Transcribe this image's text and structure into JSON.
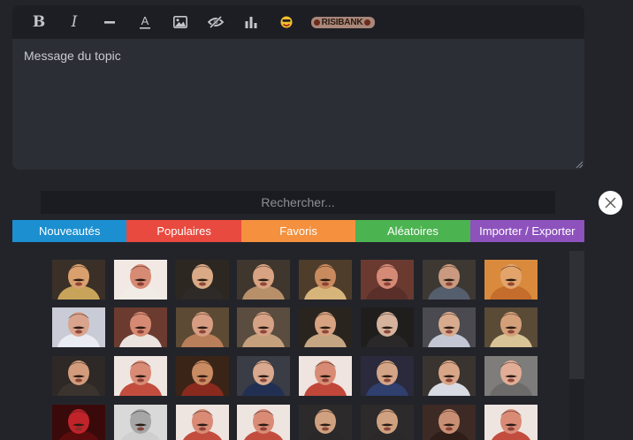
{
  "editor": {
    "toolbar": [
      {
        "name": "bold-button",
        "icon": "bold-icon",
        "label": "B"
      },
      {
        "name": "italic-button",
        "icon": "italic-icon",
        "label": "I"
      },
      {
        "name": "strikethrough-button",
        "icon": "strikethrough-icon"
      },
      {
        "name": "font-color-button",
        "icon": "font-color-icon",
        "label": "A"
      },
      {
        "name": "image-button",
        "icon": "image-icon"
      },
      {
        "name": "spoiler-button",
        "icon": "eye-slash-icon"
      },
      {
        "name": "poll-button",
        "icon": "bar-chart-icon"
      },
      {
        "name": "smiley-button",
        "icon": "smiley-icon"
      },
      {
        "name": "risibank-button",
        "icon": "risibank-logo-icon",
        "logo_text": "RISIBANK"
      }
    ],
    "placeholder": "Message du topic"
  },
  "search": {
    "placeholder": "Rechercher..."
  },
  "tabs": [
    {
      "label": "Nouveautés",
      "color": "#1c8fd0"
    },
    {
      "label": "Populaires",
      "color": "#e84a3f"
    },
    {
      "label": "Favoris",
      "color": "#f4903e"
    },
    {
      "label": "Aléatoires",
      "color": "#4cb351"
    },
    {
      "label": "Importer / Exporter",
      "color": "#8e52bd"
    }
  ],
  "colors": {
    "background": "#23242a",
    "editor": "#2c2e35",
    "toolbar": "#1d1e23",
    "search": "#1b1c21"
  },
  "stickers": {
    "rows": [
      [
        {
          "bg": "#3a3028",
          "skin": "#d9a06e",
          "shirt": "#c8a45a"
        },
        {
          "bg": "#f2e9e4",
          "skin": "#d78a74",
          "shirt": "#f1ece6"
        },
        {
          "bg": "#2d2722",
          "skin": "#d9aa85",
          "shirt": "#2e2a27"
        },
        {
          "bg": "#3f362e",
          "skin": "#d8a382",
          "shirt": "#b7906a"
        },
        {
          "bg": "#4e3d2b",
          "skin": "#c98a5e",
          "shirt": "#d7b47a"
        },
        {
          "bg": "#6a3a30",
          "skin": "#d58a76",
          "shirt": "#5a2f2a"
        },
        {
          "bg": "#3e3833",
          "skin": "#c99a7f",
          "shirt": "#545e6c"
        },
        {
          "bg": "#d98a3c",
          "skin": "#e3a46c",
          "shirt": "#c46d2c"
        }
      ],
      [
        {
          "bg": "#c9ccd6",
          "skin": "#daa38d",
          "shirt": "#e9ecf2"
        },
        {
          "bg": "#6b3b2f",
          "skin": "#d78a73",
          "shirt": "#ebe3dd"
        },
        {
          "bg": "#5c4a34",
          "skin": "#d79d82",
          "shirt": "#b97f5a"
        },
        {
          "bg": "#5a4c3e",
          "skin": "#d6a286",
          "shirt": "#c4a07c"
        },
        {
          "bg": "#2a241f",
          "skin": "#d8a380",
          "shirt": "#c5a683"
        },
        {
          "bg": "#201e1d",
          "skin": "#d6b39d",
          "shirt": "#2a2828"
        },
        {
          "bg": "#4a4a50",
          "skin": "#d8ab8e",
          "shirt": "#c2c7d3"
        },
        {
          "bg": "#5a4b37",
          "skin": "#d4a07a",
          "shirt": "#d7c395"
        }
      ],
      [
        {
          "bg": "#2e2926",
          "skin": "#d29c7c",
          "shirt": "#3b332d"
        },
        {
          "bg": "#f0e6e1",
          "skin": "#d98b76",
          "shirt": "#c24d3e"
        },
        {
          "bg": "#3a2418",
          "skin": "#c98b62",
          "shirt": "#8a2a1f"
        },
        {
          "bg": "#3a3c46",
          "skin": "#d8a98e",
          "shirt": "#213052"
        },
        {
          "bg": "#efe4df",
          "skin": "#d88b74",
          "shirt": "#c1473a"
        },
        {
          "bg": "#2a2a3c",
          "skin": "#d4a486",
          "shirt": "#2f3f6e"
        },
        {
          "bg": "#3a3430",
          "skin": "#d8a687",
          "shirt": "#d9dbe2"
        },
        {
          "bg": "#7e7d7b",
          "skin": "#e1ad96",
          "shirt": "#6c6b69"
        }
      ],
      [
        {
          "bg": "#3a0a0a",
          "skin": "#c0232a",
          "shirt": "#5a0c0c"
        },
        {
          "bg": "#d9d9d9",
          "skin": "#a6a6a6",
          "shirt": "#cfcfcf"
        },
        {
          "bg": "#efe5e0",
          "skin": "#d98b76",
          "shirt": "#c24d3e"
        },
        {
          "bg": "#efe5e0",
          "skin": "#d98b76",
          "shirt": "#c24d3e"
        },
        {
          "bg": "#2c2a2a",
          "skin": "#cfa180",
          "shirt": "#2a2828"
        },
        {
          "bg": "#2c2a2a",
          "skin": "#cfa180",
          "shirt": "#2a2828"
        },
        {
          "bg": "#3d2a25",
          "skin": "#c98f74",
          "shirt": "#2e1d18"
        },
        {
          "bg": "#efe5e0",
          "skin": "#d98b76",
          "shirt": "#c24d3e"
        }
      ]
    ]
  }
}
